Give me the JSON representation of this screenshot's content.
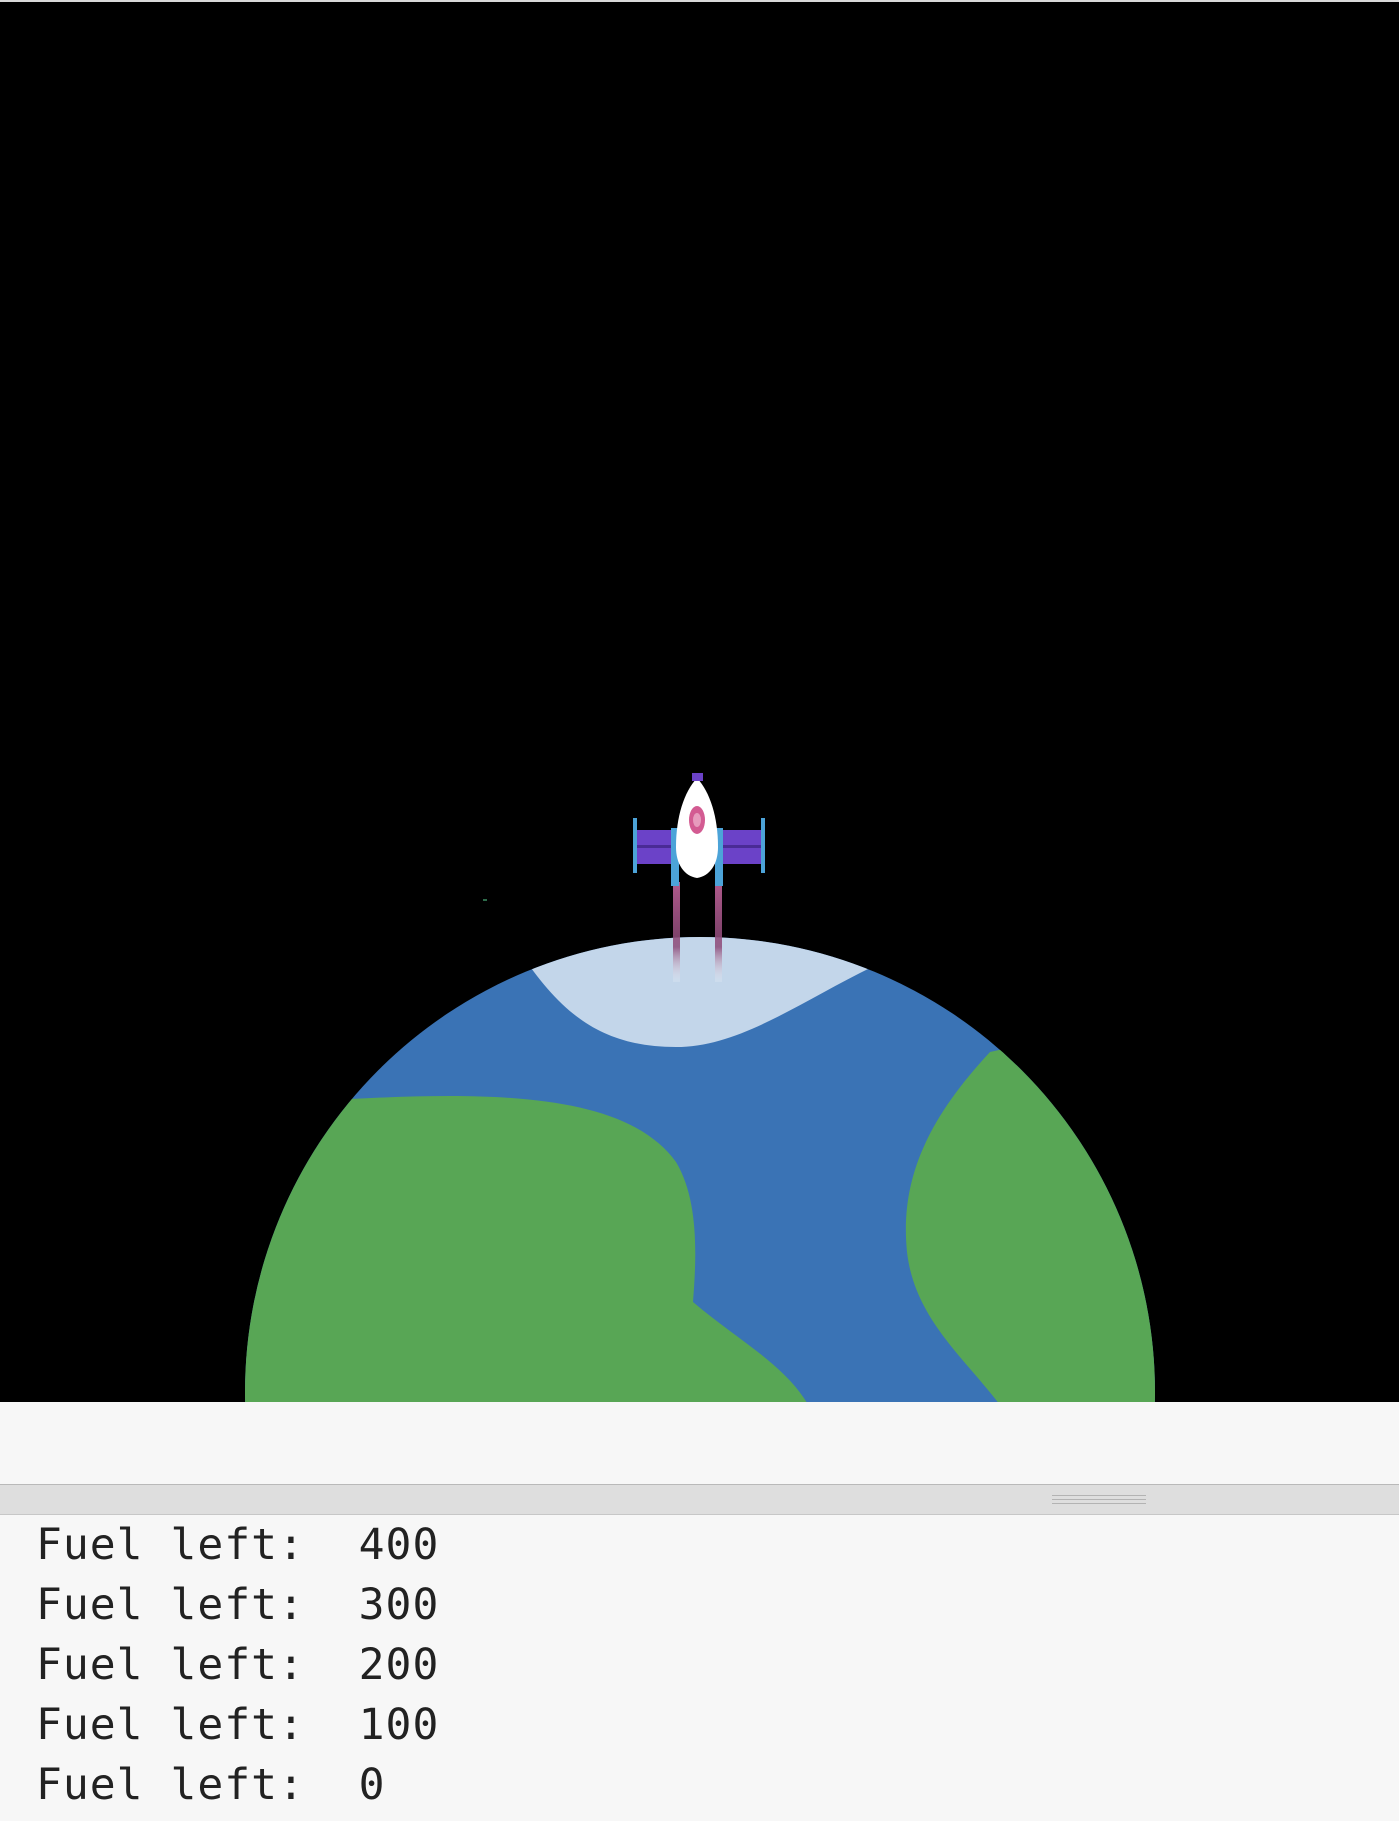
{
  "game": {
    "scene": "space-launch",
    "colors": {
      "space": "#000000",
      "ocean": "#3a73b5",
      "land": "#58a655",
      "ice": "#c3d6ea",
      "ship_body": "#ffffff",
      "ship_wings": "#6b42c8",
      "ship_trim": "#4ca3d8",
      "ship_cockpit": "#d35b92",
      "exhaust": "#b05a8c"
    }
  },
  "console": {
    "lines": [
      {
        "label": "Fuel left:",
        "value": "400"
      },
      {
        "label": "Fuel left:",
        "value": "300"
      },
      {
        "label": "Fuel left:",
        "value": "200"
      },
      {
        "label": "Fuel left:",
        "value": "100"
      },
      {
        "label": "Fuel left:",
        "value": "0"
      }
    ]
  }
}
